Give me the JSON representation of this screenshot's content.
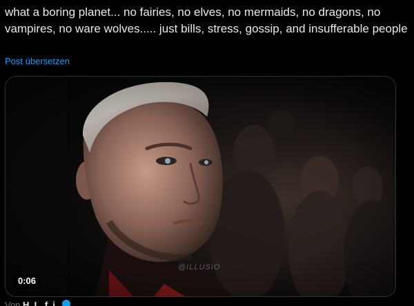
{
  "tweet": {
    "text": "what a boring planet... no fairies, no elves, no mermaids, no dragons, no vampires, no ware wolves..... just bills, stress, gossip, and insufferable people",
    "translate_label": "Post übersetzen"
  },
  "media": {
    "duration": "0:06",
    "watermark": "@ILLUSIO"
  },
  "footer": {
    "prefix": "Von",
    "name": "H. L. f. i."
  },
  "colors": {
    "background": "#000000",
    "text": "#e7e9ea",
    "link": "#1d9bf0",
    "muted": "#71767b",
    "border": "#2f3336"
  }
}
